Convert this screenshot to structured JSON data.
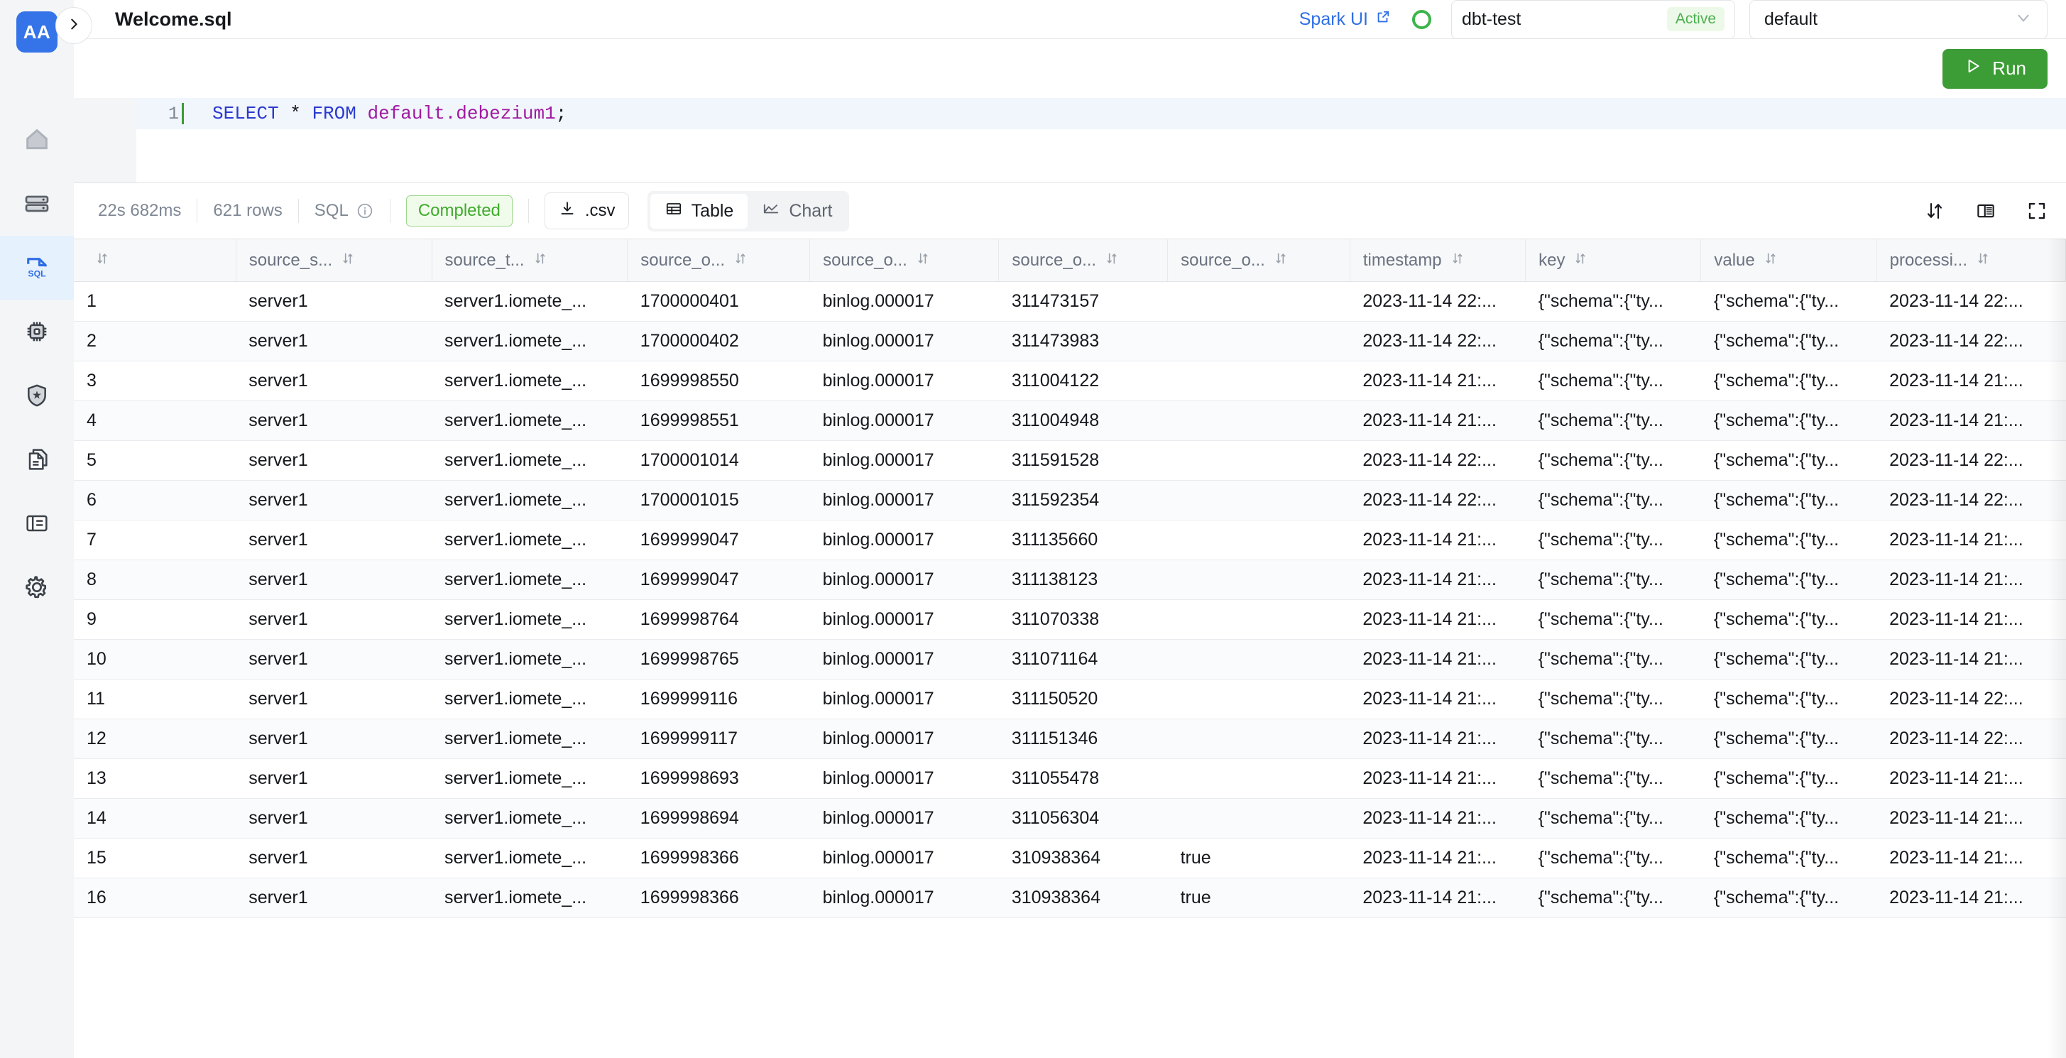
{
  "sidebar": {
    "logo_text": "AA",
    "items": [
      {
        "icon": "home-icon",
        "name": "home"
      },
      {
        "icon": "database-icon",
        "name": "database"
      },
      {
        "icon": "sql-file-icon",
        "name": "sql",
        "active": true
      },
      {
        "icon": "chip-icon",
        "name": "compute"
      },
      {
        "icon": "shield-star-icon",
        "name": "security"
      },
      {
        "icon": "documents-icon",
        "name": "documents"
      },
      {
        "icon": "notebook-icon",
        "name": "notebook"
      },
      {
        "icon": "gear-icon",
        "name": "settings"
      }
    ]
  },
  "header": {
    "title": "Welcome.sql",
    "spark_link": "Spark UI",
    "cluster_name": "dbt-test",
    "cluster_status": "Active",
    "database": "default"
  },
  "toolbar": {
    "run_label": "Run"
  },
  "editor": {
    "line_number": "1",
    "code": {
      "kw1": "SELECT",
      "star": "*",
      "kw2": "FROM",
      "identifier": "default.debezium1",
      "semicolon": ";"
    }
  },
  "results": {
    "duration": "22s 682ms",
    "row_count": "621 rows",
    "lang": "SQL",
    "status": "Completed",
    "csv_label": ".csv",
    "view_table": "Table",
    "view_chart": "Chart",
    "active_view": "Table"
  },
  "table": {
    "columns": [
      {
        "label": "",
        "key": "idx"
      },
      {
        "label": "source_s...",
        "key": "source_server"
      },
      {
        "label": "source_t...",
        "key": "source_table"
      },
      {
        "label": "source_o...",
        "key": "source_ts"
      },
      {
        "label": "source_o...",
        "key": "source_binlog"
      },
      {
        "label": "source_o...",
        "key": "source_pos"
      },
      {
        "label": "source_o...",
        "key": "source_snapshot"
      },
      {
        "label": "timestamp",
        "key": "timestamp"
      },
      {
        "label": "key",
        "key": "key"
      },
      {
        "label": "value",
        "key": "value"
      },
      {
        "label": "processi...",
        "key": "processing"
      }
    ],
    "rows": [
      {
        "idx": "1",
        "source_server": "server1",
        "source_table": "server1.iomete_...",
        "source_ts": "1700000401",
        "source_binlog": "binlog.000017",
        "source_pos": "311473157",
        "source_snapshot": "",
        "timestamp": "2023-11-14 22:...",
        "key": "{\"schema\":{\"ty...",
        "value": "{\"schema\":{\"ty...",
        "processing": "2023-11-14 22:..."
      },
      {
        "idx": "2",
        "source_server": "server1",
        "source_table": "server1.iomete_...",
        "source_ts": "1700000402",
        "source_binlog": "binlog.000017",
        "source_pos": "311473983",
        "source_snapshot": "",
        "timestamp": "2023-11-14 22:...",
        "key": "{\"schema\":{\"ty...",
        "value": "{\"schema\":{\"ty...",
        "processing": "2023-11-14 22:..."
      },
      {
        "idx": "3",
        "source_server": "server1",
        "source_table": "server1.iomete_...",
        "source_ts": "1699998550",
        "source_binlog": "binlog.000017",
        "source_pos": "311004122",
        "source_snapshot": "",
        "timestamp": "2023-11-14 21:...",
        "key": "{\"schema\":{\"ty...",
        "value": "{\"schema\":{\"ty...",
        "processing": "2023-11-14 21:..."
      },
      {
        "idx": "4",
        "source_server": "server1",
        "source_table": "server1.iomete_...",
        "source_ts": "1699998551",
        "source_binlog": "binlog.000017",
        "source_pos": "311004948",
        "source_snapshot": "",
        "timestamp": "2023-11-14 21:...",
        "key": "{\"schema\":{\"ty...",
        "value": "{\"schema\":{\"ty...",
        "processing": "2023-11-14 21:..."
      },
      {
        "idx": "5",
        "source_server": "server1",
        "source_table": "server1.iomete_...",
        "source_ts": "1700001014",
        "source_binlog": "binlog.000017",
        "source_pos": "311591528",
        "source_snapshot": "",
        "timestamp": "2023-11-14 22:...",
        "key": "{\"schema\":{\"ty...",
        "value": "{\"schema\":{\"ty...",
        "processing": "2023-11-14 22:..."
      },
      {
        "idx": "6",
        "source_server": "server1",
        "source_table": "server1.iomete_...",
        "source_ts": "1700001015",
        "source_binlog": "binlog.000017",
        "source_pos": "311592354",
        "source_snapshot": "",
        "timestamp": "2023-11-14 22:...",
        "key": "{\"schema\":{\"ty...",
        "value": "{\"schema\":{\"ty...",
        "processing": "2023-11-14 22:..."
      },
      {
        "idx": "7",
        "source_server": "server1",
        "source_table": "server1.iomete_...",
        "source_ts": "1699999047",
        "source_binlog": "binlog.000017",
        "source_pos": "311135660",
        "source_snapshot": "",
        "timestamp": "2023-11-14 21:...",
        "key": "{\"schema\":{\"ty...",
        "value": "{\"schema\":{\"ty...",
        "processing": "2023-11-14 21:..."
      },
      {
        "idx": "8",
        "source_server": "server1",
        "source_table": "server1.iomete_...",
        "source_ts": "1699999047",
        "source_binlog": "binlog.000017",
        "source_pos": "311138123",
        "source_snapshot": "",
        "timestamp": "2023-11-14 21:...",
        "key": "{\"schema\":{\"ty...",
        "value": "{\"schema\":{\"ty...",
        "processing": "2023-11-14 21:..."
      },
      {
        "idx": "9",
        "source_server": "server1",
        "source_table": "server1.iomete_...",
        "source_ts": "1699998764",
        "source_binlog": "binlog.000017",
        "source_pos": "311070338",
        "source_snapshot": "",
        "timestamp": "2023-11-14 21:...",
        "key": "{\"schema\":{\"ty...",
        "value": "{\"schema\":{\"ty...",
        "processing": "2023-11-14 21:..."
      },
      {
        "idx": "10",
        "source_server": "server1",
        "source_table": "server1.iomete_...",
        "source_ts": "1699998765",
        "source_binlog": "binlog.000017",
        "source_pos": "311071164",
        "source_snapshot": "",
        "timestamp": "2023-11-14 21:...",
        "key": "{\"schema\":{\"ty...",
        "value": "{\"schema\":{\"ty...",
        "processing": "2023-11-14 21:..."
      },
      {
        "idx": "11",
        "source_server": "server1",
        "source_table": "server1.iomete_...",
        "source_ts": "1699999116",
        "source_binlog": "binlog.000017",
        "source_pos": "311150520",
        "source_snapshot": "",
        "timestamp": "2023-11-14 21:...",
        "key": "{\"schema\":{\"ty...",
        "value": "{\"schema\":{\"ty...",
        "processing": "2023-11-14 22:..."
      },
      {
        "idx": "12",
        "source_server": "server1",
        "source_table": "server1.iomete_...",
        "source_ts": "1699999117",
        "source_binlog": "binlog.000017",
        "source_pos": "311151346",
        "source_snapshot": "",
        "timestamp": "2023-11-14 21:...",
        "key": "{\"schema\":{\"ty...",
        "value": "{\"schema\":{\"ty...",
        "processing": "2023-11-14 22:..."
      },
      {
        "idx": "13",
        "source_server": "server1",
        "source_table": "server1.iomete_...",
        "source_ts": "1699998693",
        "source_binlog": "binlog.000017",
        "source_pos": "311055478",
        "source_snapshot": "",
        "timestamp": "2023-11-14 21:...",
        "key": "{\"schema\":{\"ty...",
        "value": "{\"schema\":{\"ty...",
        "processing": "2023-11-14 21:..."
      },
      {
        "idx": "14",
        "source_server": "server1",
        "source_table": "server1.iomete_...",
        "source_ts": "1699998694",
        "source_binlog": "binlog.000017",
        "source_pos": "311056304",
        "source_snapshot": "",
        "timestamp": "2023-11-14 21:...",
        "key": "{\"schema\":{\"ty...",
        "value": "{\"schema\":{\"ty...",
        "processing": "2023-11-14 21:..."
      },
      {
        "idx": "15",
        "source_server": "server1",
        "source_table": "server1.iomete_...",
        "source_ts": "1699998366",
        "source_binlog": "binlog.000017",
        "source_pos": "310938364",
        "source_snapshot": "true",
        "timestamp": "2023-11-14 21:...",
        "key": "{\"schema\":{\"ty...",
        "value": "{\"schema\":{\"ty...",
        "processing": "2023-11-14 21:..."
      },
      {
        "idx": "16",
        "source_server": "server1",
        "source_table": "server1.iomete_...",
        "source_ts": "1699998366",
        "source_binlog": "binlog.000017",
        "source_pos": "310938364",
        "source_snapshot": "true",
        "timestamp": "2023-11-14 21:...",
        "key": "{\"schema\":{\"ty...",
        "value": "{\"schema\":{\"ty...",
        "processing": "2023-11-14 21:..."
      }
    ]
  },
  "colors": {
    "accent_blue": "#3574e8",
    "run_green": "#3c9c35",
    "status_green": "#3bb54a",
    "active_nav_bg": "#e6f1fe"
  }
}
